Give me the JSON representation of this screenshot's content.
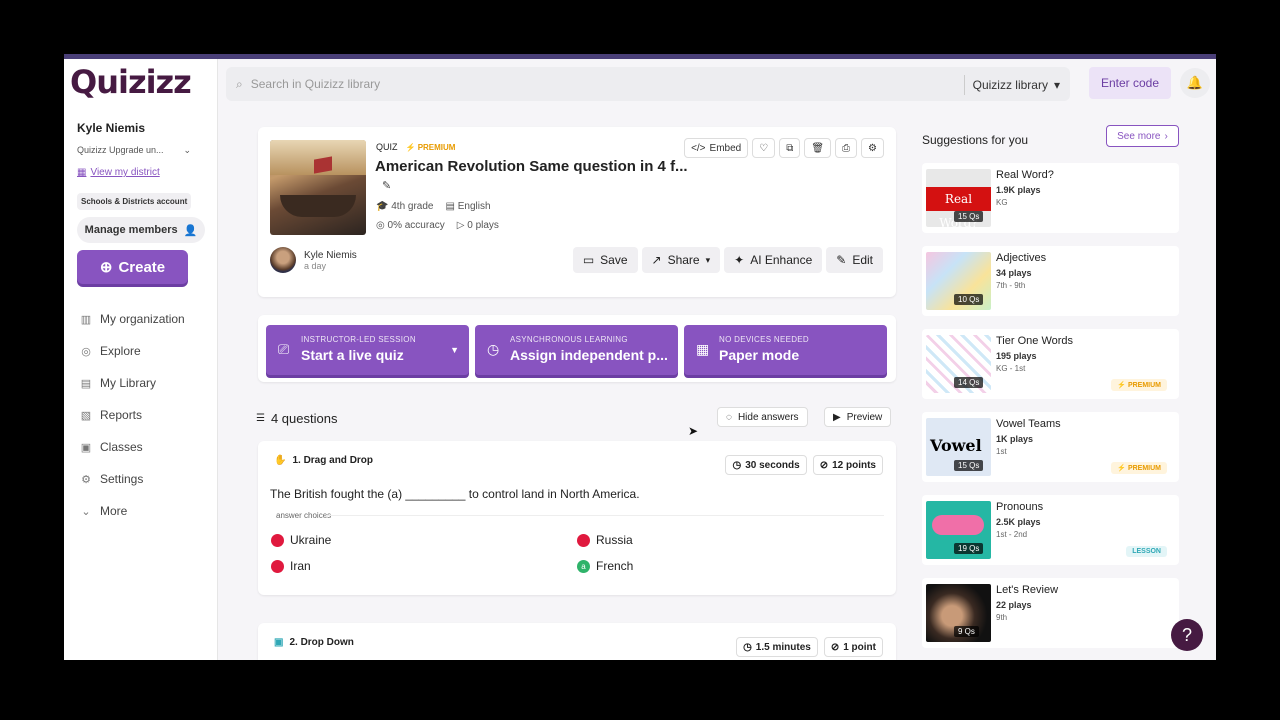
{
  "sidebar": {
    "logo": "Quizizz",
    "user_name": "Kyle Niemis",
    "plan": "Quizizz Upgrade un...",
    "district_link": "View my district",
    "account_pill": "Schools & Districts account",
    "manage_members": "Manage members",
    "create": "Create",
    "nav": [
      {
        "label": "My organization",
        "icon": "building-icon"
      },
      {
        "label": "Explore",
        "icon": "compass-icon"
      },
      {
        "label": "My Library",
        "icon": "library-icon"
      },
      {
        "label": "Reports",
        "icon": "reports-icon"
      },
      {
        "label": "Classes",
        "icon": "classes-icon"
      },
      {
        "label": "Settings",
        "icon": "gear-icon"
      },
      {
        "label": "More",
        "icon": "chevron-down-icon"
      }
    ]
  },
  "topbar": {
    "search_placeholder": "Search in Quizizz library",
    "library_select": "Quizizz library",
    "enter_code": "Enter code"
  },
  "quiz": {
    "type": "QUIZ",
    "premium": "PREMIUM",
    "title": "American Revolution Same question in 4 f...",
    "grade": "4th grade",
    "language": "English",
    "accuracy": "0% accuracy",
    "plays": "0 plays",
    "embed": "Embed",
    "author": "Kyle Niemis",
    "time": "a day",
    "actions": {
      "save": "Save",
      "share": "Share",
      "ai_enhance": "AI Enhance",
      "edit": "Edit"
    }
  },
  "modes": [
    {
      "sub": "INSTRUCTOR-LED SESSION",
      "label": "Start a live quiz"
    },
    {
      "sub": "ASYNCHRONOUS LEARNING",
      "label": "Assign independent p..."
    },
    {
      "sub": "NO DEVICES NEEDED",
      "label": "Paper mode"
    }
  ],
  "questions_header": {
    "count": "4 questions",
    "hide_answers": "Hide answers",
    "preview": "Preview"
  },
  "question1": {
    "type": "1. Drag and Drop",
    "time": "30 seconds",
    "points": "12 points",
    "text": "The British fought the (a) _________ to control land in North America.",
    "answer_label": "answer choices",
    "choices": [
      {
        "label": "Ukraine",
        "correct": false
      },
      {
        "label": "Russia",
        "correct": false
      },
      {
        "label": "Iran",
        "correct": false
      },
      {
        "label": "French",
        "correct": true,
        "marker": "a"
      }
    ]
  },
  "question2": {
    "type": "2. Drop Down",
    "time": "1.5 minutes",
    "points": "1 point"
  },
  "suggestions": {
    "title": "Suggestions for you",
    "see_more": "See more",
    "items": [
      {
        "title": "Real Word?",
        "plays": "1.9K plays",
        "grade": "KG",
        "qs": "15 Qs",
        "tag": ""
      },
      {
        "title": "Adjectives",
        "plays": "34 plays",
        "grade": "7th - 9th",
        "qs": "10 Qs",
        "tag": ""
      },
      {
        "title": "Tier One Words",
        "plays": "195 plays",
        "grade": "KG - 1st",
        "qs": "14 Qs",
        "tag": "PREMIUM"
      },
      {
        "title": "Vowel Teams",
        "plays": "1K plays",
        "grade": "1st",
        "qs": "15 Qs",
        "tag": "PREMIUM"
      },
      {
        "title": "Pronouns",
        "plays": "2.5K plays",
        "grade": "1st - 2nd",
        "qs": "19 Qs",
        "tag": "LESSON"
      },
      {
        "title": "Let's Review",
        "plays": "22 plays",
        "grade": "9th",
        "qs": "9 Qs",
        "tag": ""
      }
    ],
    "thumb_text": {
      "real_word": "Real Word?",
      "vowel": "Vowel"
    }
  },
  "colors": {
    "brand": "#8854c0",
    "logo": "#461a42",
    "premium": "#e89b00",
    "wrong": "#e0193e",
    "correct": "#2fb36a"
  }
}
